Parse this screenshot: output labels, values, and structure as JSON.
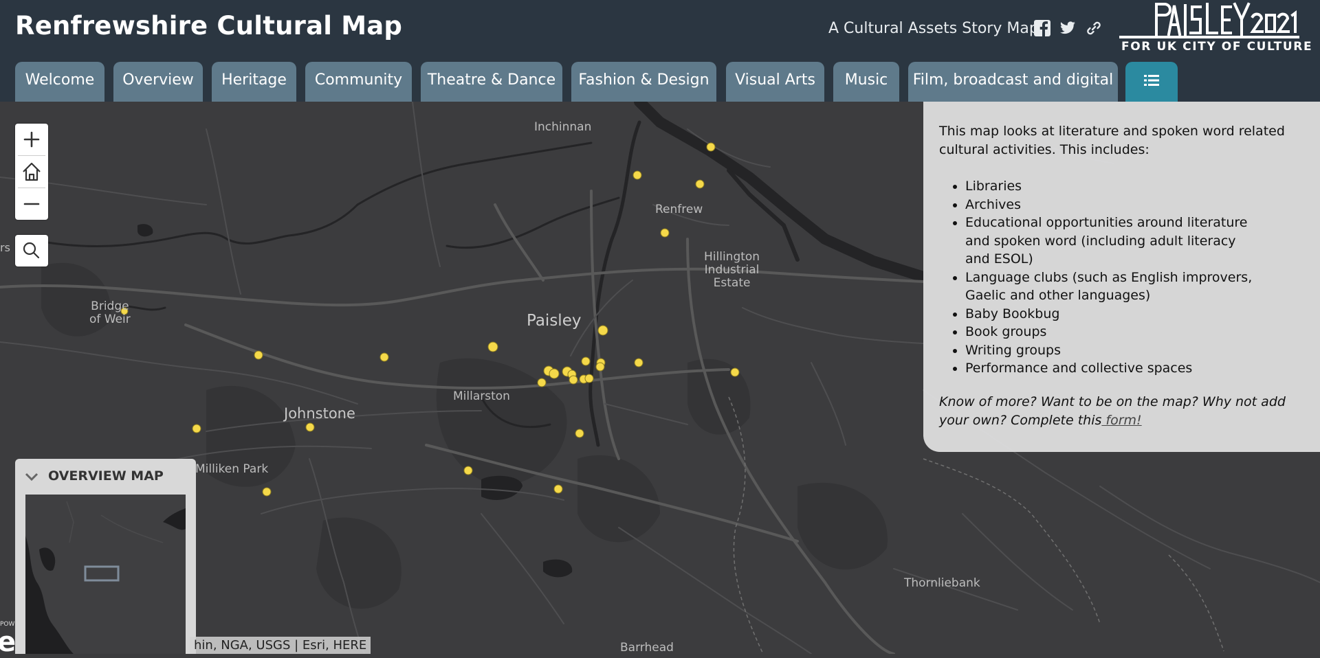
{
  "header": {
    "title": "Renfrewshire Cultural Map",
    "subtitle": "A Cultural Assets Story Map",
    "logo_sub": "FOR UK CITY OF CULTURE",
    "logo_image_text": "PAISLEY2021",
    "background_color": "#2b3641"
  },
  "share_icons": [
    "facebook-icon",
    "twitter-icon",
    "link-icon"
  ],
  "tabs": [
    {
      "label": "Welcome"
    },
    {
      "label": "Overview"
    },
    {
      "label": "Heritage"
    },
    {
      "label": "Community"
    },
    {
      "label": "Theatre & Dance"
    },
    {
      "label": "Fashion & Design"
    },
    {
      "label": "Visual Arts"
    },
    {
      "label": "Music"
    },
    {
      "label": "Film, broadcast and digital"
    },
    {
      "label": "",
      "icon": "list-icon",
      "active": true
    }
  ],
  "tab_colors": {
    "default": "#5f7a8b",
    "active": "#2b8aa0"
  },
  "map": {
    "point_color": "#f5d94a",
    "places": {
      "inchinnan": "Inchinnan",
      "renfrew": "Renfrew",
      "hillington": [
        "Hillington",
        "Industrial",
        "Estate"
      ],
      "bridge_of_weir": [
        "Bridge",
        "of Weir"
      ],
      "paisley": "Paisley",
      "millarston": "Millarston",
      "johnstone": "Johnstone",
      "milliken_park": "Milliken Park",
      "thornliebank": "Thornliebank",
      "barrhead": "Barrhead",
      "edge": "rs"
    },
    "controls": [
      "zoom-in-icon",
      "home-icon",
      "zoom-out-icon",
      "search-icon"
    ]
  },
  "panel": {
    "intro": "This map looks at literature and spoken word related cultural activities. This includes:",
    "items": [
      "Libraries",
      "Archives",
      "Educational opportunities around literature and spoken word (including adult literacy and ESOL)",
      "Language clubs (such as English improvers, Gaelic and other languages)",
      "Baby Bookbug",
      "Book groups",
      "Writing groups",
      "Performance and collective spaces"
    ],
    "note_text": "Know of more? Want to be on the map? Why not add your own? Complete this",
    "note_link": " form!"
  },
  "overview": {
    "title": "OVERVIEW MAP"
  },
  "attribution": "hin, NGA, USGS | Esri, HERE",
  "powered": {
    "small": "POW",
    "big": "e"
  }
}
